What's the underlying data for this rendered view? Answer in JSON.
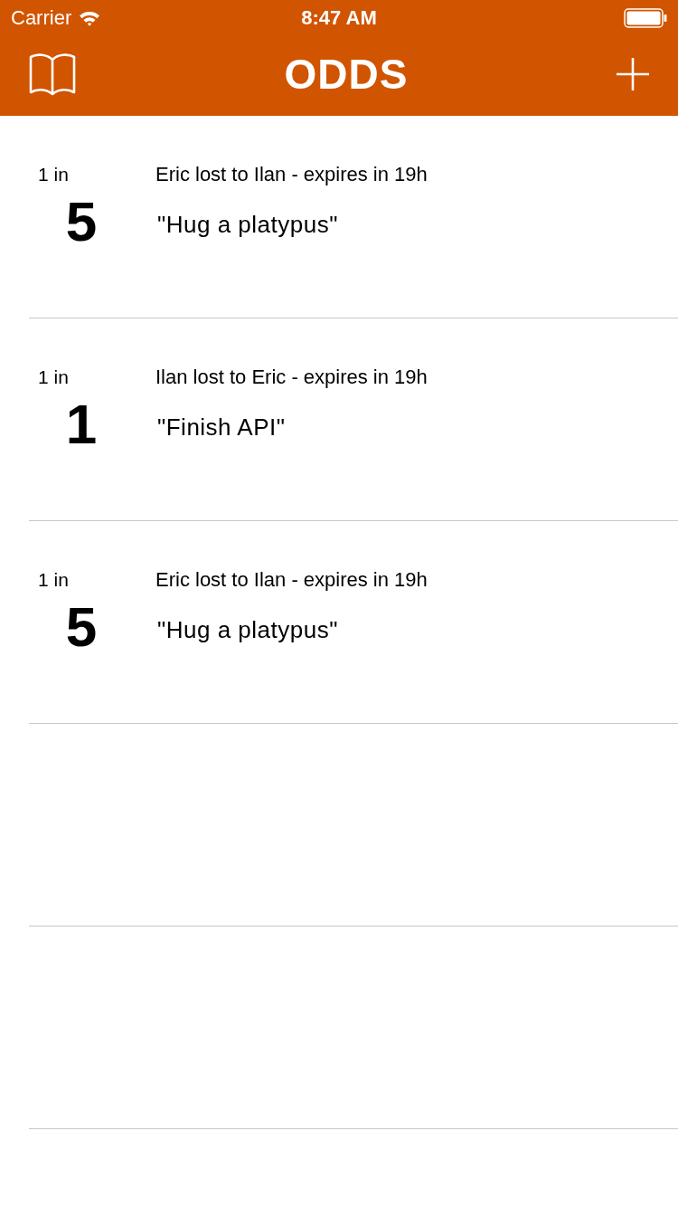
{
  "status_bar": {
    "carrier": "Carrier",
    "time": "8:47 AM"
  },
  "nav_bar": {
    "title": "ODDS"
  },
  "bets": [
    {
      "odds_prefix": "1 in",
      "odds": "5",
      "title": "Eric lost to Ilan - expires in 19h",
      "dare": "\"Hug a platypus\""
    },
    {
      "odds_prefix": "1 in",
      "odds": "1",
      "title": "Ilan lost to Eric - expires in 19h",
      "dare": "\"Finish API\""
    },
    {
      "odds_prefix": "1 in",
      "odds": "5",
      "title": "Eric lost to Ilan - expires in 19h",
      "dare": "\"Hug a platypus\""
    }
  ]
}
